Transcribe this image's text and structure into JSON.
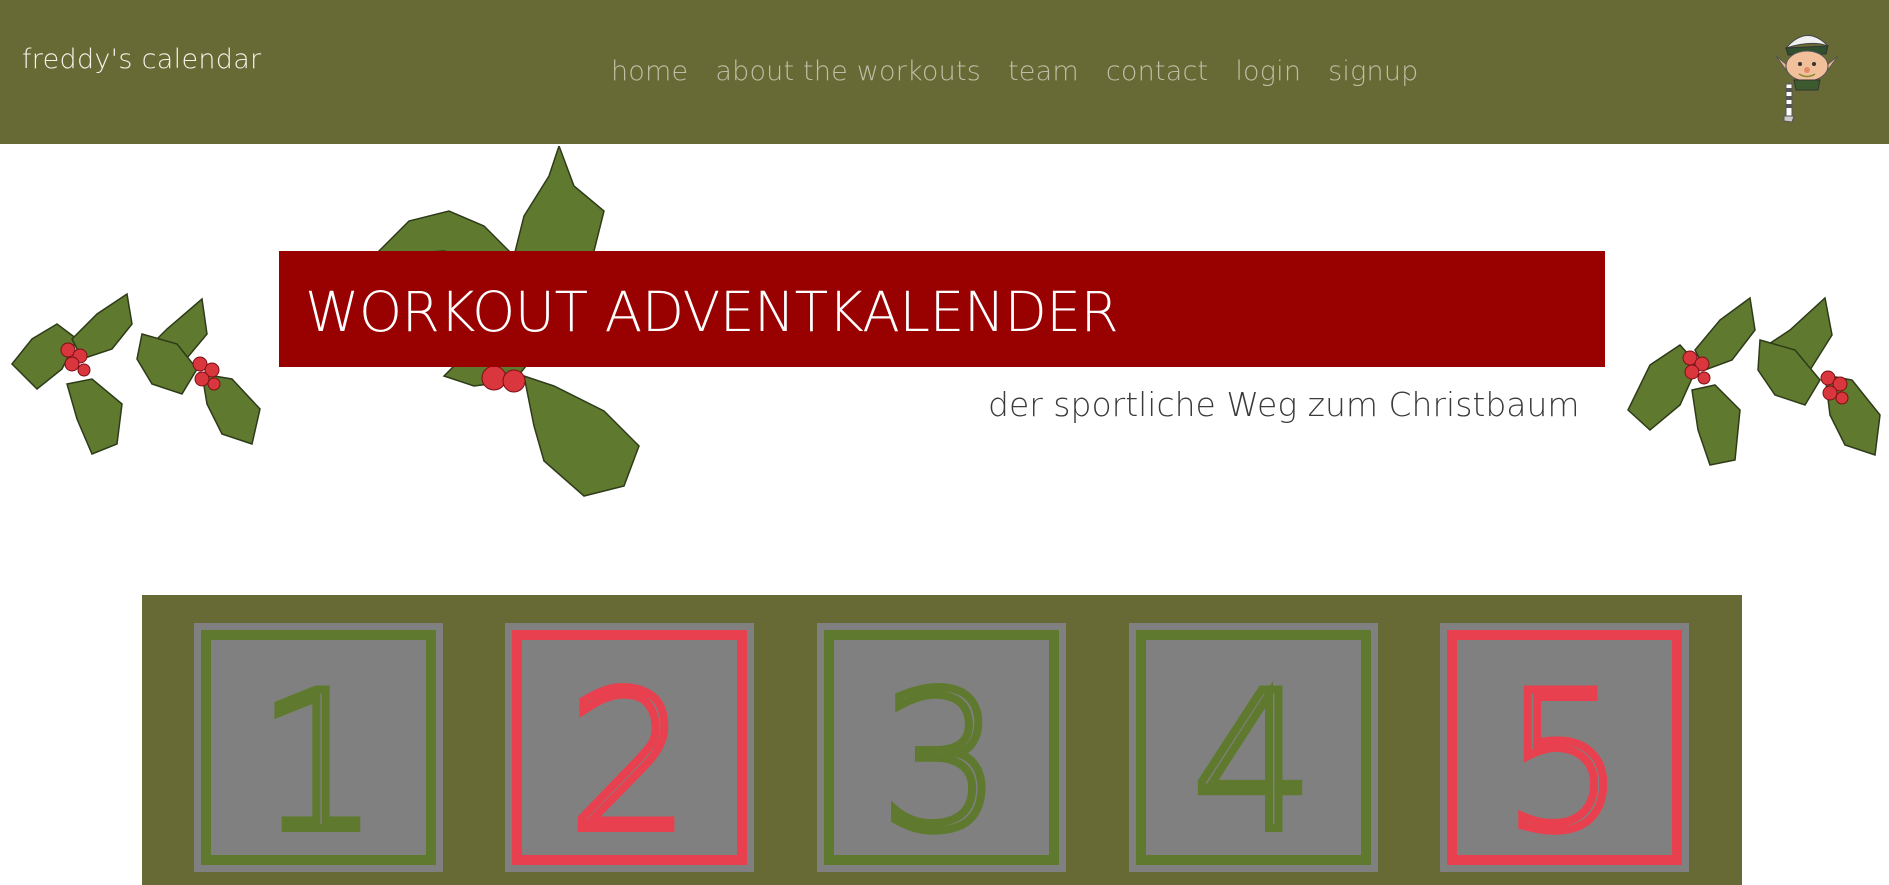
{
  "header": {
    "brand": "freddy's calendar",
    "nav": [
      "home",
      "about the workouts",
      "team",
      "contact",
      "login",
      "signup"
    ],
    "avatar_icon": "elf-icon",
    "background_color": "#676a35"
  },
  "hero": {
    "title": "WORKOUT ADVENTKALENDER",
    "subtitle": "der sportliche Weg zum Christbaum",
    "title_band_color": "#990000",
    "decoration_icon": "holly-icon"
  },
  "calendar": {
    "background_color": "#676a35",
    "doors": [
      {
        "number": "1",
        "color": "green"
      },
      {
        "number": "2",
        "color": "red"
      },
      {
        "number": "3",
        "color": "green"
      },
      {
        "number": "4",
        "color": "green"
      },
      {
        "number": "5",
        "color": "red"
      }
    ],
    "colors": {
      "green": "#5f7a2e",
      "red": "#e8404f",
      "door_fill": "#808080"
    }
  }
}
